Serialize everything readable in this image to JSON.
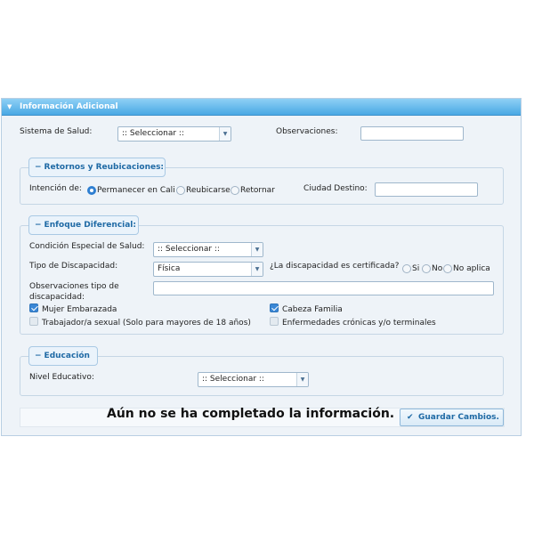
{
  "panel": {
    "title": "Información Adicional",
    "sistema_salud": {
      "label": "Sistema de Salud:",
      "selected": ":: Seleccionar ::"
    },
    "observaciones": {
      "label": "Observaciones:",
      "value": ""
    }
  },
  "retornos": {
    "legend": "Retornos y Reubicaciones:",
    "intencion_label": "Intención de:",
    "options": [
      "Permanecer en Cali",
      "Reubicarse",
      "Retornar"
    ],
    "selected_index": 0,
    "ciudad_label": "Ciudad Destino:",
    "ciudad_value": ""
  },
  "enfoque": {
    "legend": "Enfoque Diferencial:",
    "condicion": {
      "label": "Condición Especial de Salud:",
      "selected": ":: Seleccionar ::"
    },
    "discapacidad": {
      "label": "Tipo de Discapacidad:",
      "selected": "Física"
    },
    "certificada": {
      "label": "¿La discapacidad es certificada?",
      "options": [
        "Si",
        "No",
        "No aplica"
      ]
    },
    "obs_label_1": "Observaciones tipo de",
    "obs_label_2": "discapacidad:",
    "obs_value": "",
    "checks": {
      "mujer_embarazada": {
        "label": "Mujer Embarazada",
        "checked": true
      },
      "cabeza_familia": {
        "label": "Cabeza Familia",
        "checked": true
      },
      "trabajador_sexual": {
        "label": "Trabajador/a sexual (Solo para mayores de 18 años)",
        "checked": false
      },
      "enfermedades": {
        "label": "Enfermedades crónicas y/o terminales",
        "checked": false
      }
    }
  },
  "educacion": {
    "legend": "Educación",
    "nivel": {
      "label": "Nivel Educativo:",
      "selected": ":: Seleccionar ::"
    }
  },
  "footer": {
    "status_message": "Aún no se ha completado la información.",
    "save_label": "Guardar Cambios."
  },
  "icons": {
    "collapse": "triangle-down-icon",
    "legend_toggle": "minus-icon",
    "dropdown": "chevron-down-icon",
    "save": "check-icon"
  }
}
